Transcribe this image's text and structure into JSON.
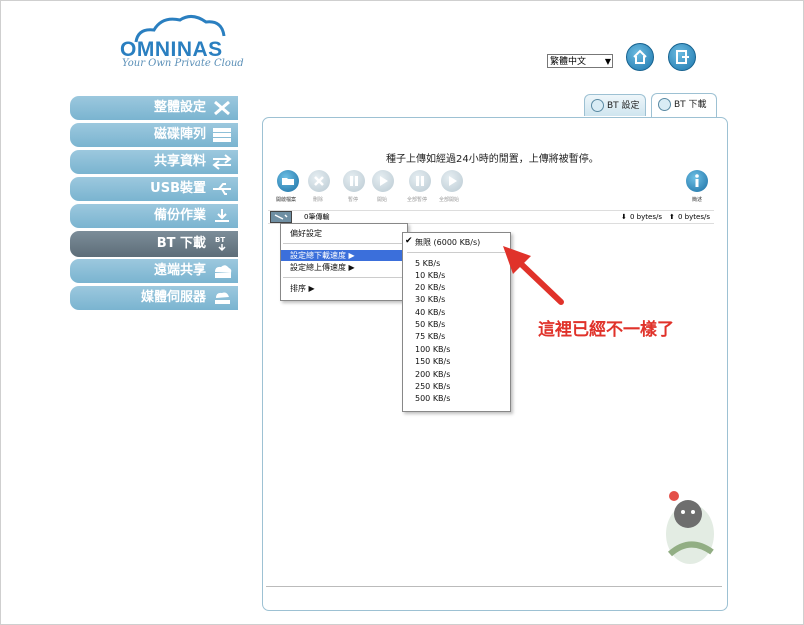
{
  "header": {
    "logo_text": "OMNINAS",
    "logo_tagline": "Your Own Private Cloud",
    "language_selected": "繁體中文",
    "home_icon": "home-icon",
    "logout_icon": "logout-icon"
  },
  "sidebar": {
    "items": [
      {
        "label": "整體設定",
        "icon": "tools-icon"
      },
      {
        "label": "磁碟陣列",
        "icon": "disk-array-icon"
      },
      {
        "label": "共享資料",
        "icon": "share-arrows-icon"
      },
      {
        "label": "USB裝置",
        "icon": "usb-icon"
      },
      {
        "label": "備份作業",
        "icon": "backup-icon"
      },
      {
        "label": "BT 下載",
        "icon": "bt-icon",
        "active": true
      },
      {
        "label": "遠端共享",
        "icon": "cloud-folder-icon"
      },
      {
        "label": "媒體伺服器",
        "icon": "media-server-icon"
      }
    ]
  },
  "tabs": {
    "bt_settings": "BT 設定",
    "bt_download": "BT 下載"
  },
  "panel": {
    "notice": "種子上傳如經過24小時的閒置，上傳將被暫停。",
    "toolbar": {
      "open_label": "開啟檔案",
      "delete_label": "刪除",
      "pause_label": "暫停",
      "start_label": "開始",
      "pause_all_label": "全部暫停",
      "start_all_label": "全部開始",
      "info_label": "簡述"
    },
    "status": {
      "peers": "0筆傳輸",
      "down_speed": "0 bytes/s",
      "up_speed": "0 bytes/s"
    }
  },
  "context_menu": {
    "preferences": "偏好設定",
    "download_limit": "設定總下載速度 ▶",
    "upload_limit": "設定總上傳速度 ▶",
    "sort": "排序 ▶"
  },
  "speed_submenu": {
    "unlimited": "無限 (6000 KB/s)",
    "options": [
      "5 KB/s",
      "10 KB/s",
      "20 KB/s",
      "30 KB/s",
      "40 KB/s",
      "50 KB/s",
      "75 KB/s",
      "100 KB/s",
      "150 KB/s",
      "200 KB/s",
      "250 KB/s",
      "500 KB/s"
    ]
  },
  "annotation": {
    "callout": "這裡已經不一樣了",
    "color": "#e0322a"
  },
  "colors": {
    "sidebar": "#8bbfd8",
    "sidebar_active": "#6b7c88",
    "menu_highlight": "#3b6fdb",
    "brand": "#2a7fc0"
  }
}
